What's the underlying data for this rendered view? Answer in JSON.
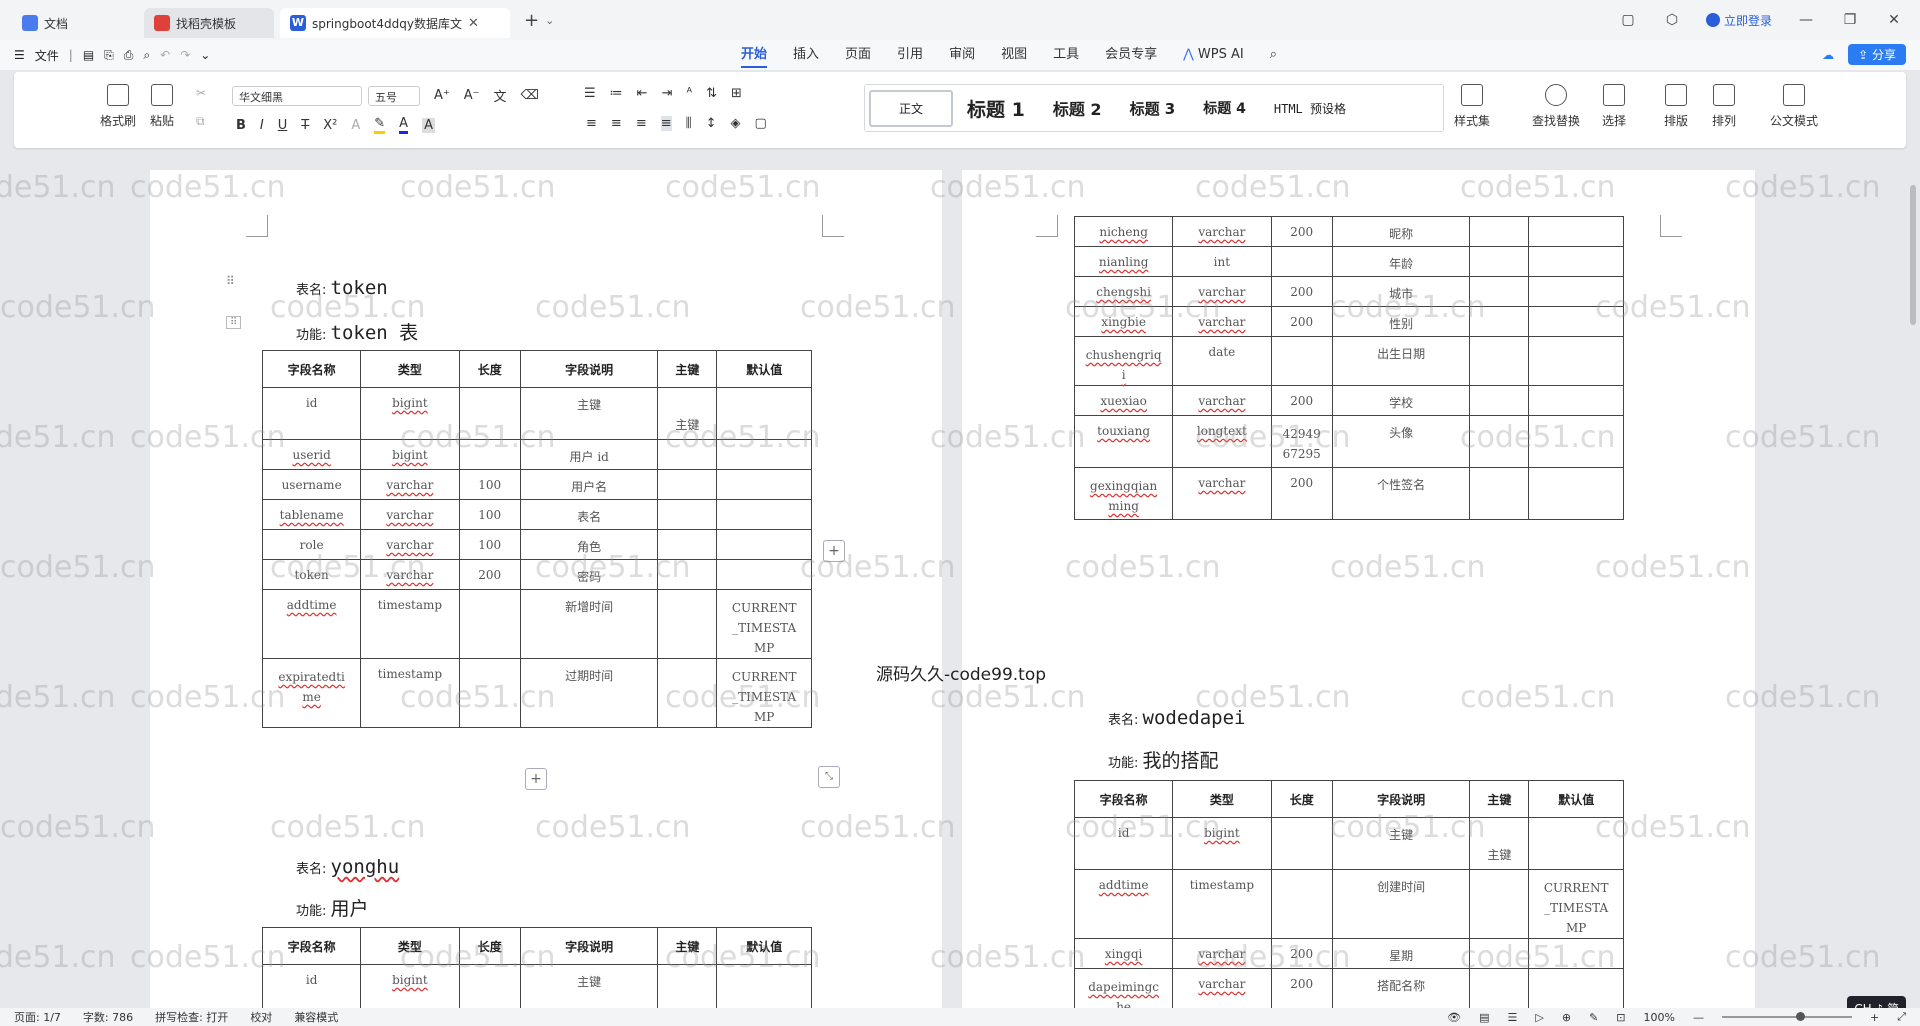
{
  "tabs": [
    {
      "label": "文档",
      "icon": "doc-icon"
    },
    {
      "label": "找稻壳模板",
      "icon": "pdf-icon"
    },
    {
      "label": "springboot4ddqy数据库文",
      "icon": "word-icon"
    }
  ],
  "titlebar": {
    "login": "立即登录"
  },
  "menu": {
    "file": "文件",
    "tabs": [
      "开始",
      "插入",
      "页面",
      "引用",
      "审阅",
      "视图",
      "工具",
      "会员专享"
    ],
    "wps_ai": "WPS AI",
    "share": "分享"
  },
  "ribbon": {
    "format_painter": "格式刷",
    "paste": "粘贴",
    "font_name": "华文细黑",
    "font_size": "五号",
    "styles": [
      "正文",
      "标题 1",
      "标题 2",
      "标题 3",
      "标题 4",
      "HTML 预设格"
    ],
    "style_set": "样式集",
    "find_replace": "查找替换",
    "select": "选择",
    "layout": "排版",
    "arrange": "排列",
    "official_mode": "公文模式"
  },
  "watermark": "code51.cn",
  "source_watermark": "源码久久-code99.top",
  "labels": {
    "table_name": "表名:",
    "function": "功能:"
  },
  "headers": [
    "字段名称",
    "类型",
    "长度",
    "字段说明",
    "主键",
    "默认值"
  ],
  "page1": {
    "token": {
      "name": "token",
      "func": "token 表",
      "rows": [
        [
          "id",
          "bigint",
          "",
          "主键",
          "主键",
          ""
        ],
        [
          "userid",
          "bigint",
          "",
          "用户 id",
          "",
          ""
        ],
        [
          "username",
          "varchar",
          "100",
          "用户名",
          "",
          ""
        ],
        [
          "tablename",
          "varchar",
          "100",
          "表名",
          "",
          ""
        ],
        [
          "role",
          "varchar",
          "100",
          "角色",
          "",
          ""
        ],
        [
          "token",
          "varchar",
          "200",
          "密码",
          "",
          ""
        ],
        [
          "addtime",
          "timestamp",
          "",
          "新增时间",
          "",
          "CURRENT_TIMESTAMP"
        ],
        [
          "expiratedtime",
          "timestamp",
          "",
          "过期时间",
          "",
          "CURRENT_TIMESTAMP"
        ]
      ]
    },
    "yonghu": {
      "name": "yonghu",
      "func": "用户",
      "rows": [
        [
          "id",
          "bigint",
          "",
          "主键",
          "",
          ""
        ]
      ]
    }
  },
  "page2": {
    "yonghu_cont": {
      "rows": [
        [
          "nicheng",
          "varchar",
          "200",
          "昵称",
          "",
          ""
        ],
        [
          "nianling",
          "int",
          "",
          "年龄",
          "",
          ""
        ],
        [
          "chengshi",
          "varchar",
          "200",
          "城市",
          "",
          ""
        ],
        [
          "xingbie",
          "varchar",
          "200",
          "性别",
          "",
          ""
        ],
        [
          "chushengriqi",
          "date",
          "",
          "出生日期",
          "",
          ""
        ],
        [
          "xuexiao",
          "varchar",
          "200",
          "学校",
          "",
          ""
        ],
        [
          "touxiang",
          "longtext",
          "4294967295",
          "头像",
          "",
          ""
        ],
        [
          "gexingqianming",
          "varchar",
          "200",
          "个性签名",
          "",
          ""
        ]
      ]
    },
    "wodedapei": {
      "name": "wodedapei",
      "func": "我的搭配",
      "rows": [
        [
          "id",
          "bigint",
          "",
          "主键",
          "主键",
          ""
        ],
        [
          "addtime",
          "timestamp",
          "",
          "创建时间",
          "",
          "CURRENT_TIMESTAMP"
        ],
        [
          "xingqi",
          "varchar",
          "200",
          "星期",
          "",
          ""
        ],
        [
          "dapeimingche",
          "varchar",
          "200",
          "搭配名称",
          "",
          ""
        ]
      ]
    }
  },
  "status": {
    "page": "页面: 1/7",
    "words": "字数: 786",
    "spell": "拼写检查: 打开",
    "proof": "校对",
    "compat": "兼容模式",
    "zoom": "100%",
    "ime": "CH ♪ 简"
  }
}
